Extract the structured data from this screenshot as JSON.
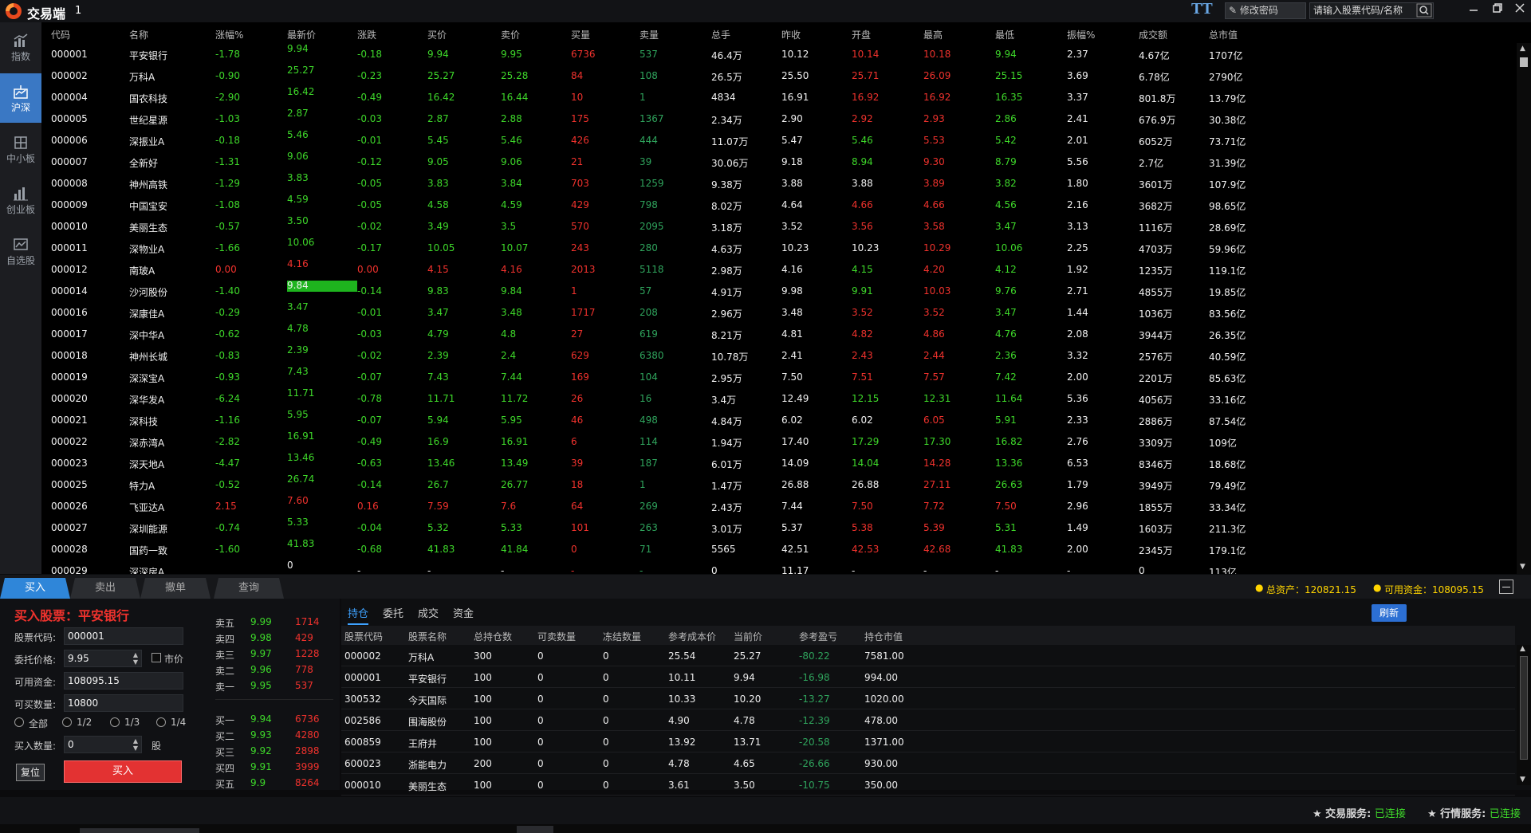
{
  "app": {
    "title": "交易端",
    "version": "1",
    "font_btn": "TT",
    "change_pwd": "修改密码",
    "search_placeholder": "请输入股票代码/名称"
  },
  "sidebar": [
    {
      "label": "指数",
      "icon": "bar-chart-icon"
    },
    {
      "label": "沪深",
      "icon": "market-icon"
    },
    {
      "label": "中小板",
      "icon": "sme-board-icon"
    },
    {
      "label": "创业板",
      "icon": "growth-board-icon"
    },
    {
      "label": "自选股",
      "icon": "watchlist-icon"
    }
  ],
  "quote_columns": [
    "代码",
    "名称",
    "涨幅%",
    "最新价",
    "涨跌",
    "买价",
    "卖价",
    "买量",
    "卖量",
    "总手",
    "昨收",
    "开盘",
    "最高",
    "最低",
    "振幅%",
    "成交额",
    "总市值"
  ],
  "quotes": [
    [
      "000001",
      "平安银行",
      "-1.78",
      "9.94",
      "-0.18",
      "9.94",
      "9.95",
      "6736",
      "537",
      "46.4万",
      "10.12",
      "10.14",
      "10.18",
      "9.94",
      "2.37",
      "4.67亿",
      "1707亿"
    ],
    [
      "000002",
      "万科A",
      "-0.90",
      "25.27",
      "-0.23",
      "25.27",
      "25.28",
      "84",
      "108",
      "26.5万",
      "25.50",
      "25.71",
      "26.09",
      "25.15",
      "3.69",
      "6.78亿",
      "2790亿"
    ],
    [
      "000004",
      "国农科技",
      "-2.90",
      "16.42",
      "-0.49",
      "16.42",
      "16.44",
      "10",
      "1",
      "4834",
      "16.91",
      "16.92",
      "16.92",
      "16.35",
      "3.37",
      "801.8万",
      "13.79亿"
    ],
    [
      "000005",
      "世纪星源",
      "-1.03",
      "2.87",
      "-0.03",
      "2.87",
      "2.88",
      "175",
      "1367",
      "2.34万",
      "2.90",
      "2.92",
      "2.93",
      "2.86",
      "2.41",
      "676.9万",
      "30.38亿"
    ],
    [
      "000006",
      "深振业A",
      "-0.18",
      "5.46",
      "-0.01",
      "5.45",
      "5.46",
      "426",
      "444",
      "11.07万",
      "5.47",
      "5.46",
      "5.53",
      "5.42",
      "2.01",
      "6052万",
      "73.71亿"
    ],
    [
      "000007",
      "全新好",
      "-1.31",
      "9.06",
      "-0.12",
      "9.05",
      "9.06",
      "21",
      "39",
      "30.06万",
      "9.18",
      "8.94",
      "9.30",
      "8.79",
      "5.56",
      "2.7亿",
      "31.39亿"
    ],
    [
      "000008",
      "神州高铁",
      "-1.29",
      "3.83",
      "-0.05",
      "3.83",
      "3.84",
      "703",
      "1259",
      "9.38万",
      "3.88",
      "3.88",
      "3.89",
      "3.82",
      "1.80",
      "3601万",
      "107.9亿"
    ],
    [
      "000009",
      "中国宝安",
      "-1.08",
      "4.59",
      "-0.05",
      "4.58",
      "4.59",
      "429",
      "798",
      "8.02万",
      "4.64",
      "4.66",
      "4.66",
      "4.56",
      "2.16",
      "3682万",
      "98.65亿"
    ],
    [
      "000010",
      "美丽生态",
      "-0.57",
      "3.50",
      "-0.02",
      "3.49",
      "3.5",
      "570",
      "2095",
      "3.18万",
      "3.52",
      "3.56",
      "3.58",
      "3.47",
      "3.13",
      "1116万",
      "28.69亿"
    ],
    [
      "000011",
      "深物业A",
      "-1.66",
      "10.06",
      "-0.17",
      "10.05",
      "10.07",
      "243",
      "280",
      "4.63万",
      "10.23",
      "10.23",
      "10.29",
      "10.06",
      "2.25",
      "4703万",
      "59.96亿"
    ],
    [
      "000012",
      "南玻A",
      "0.00",
      "4.16",
      "0.00",
      "4.15",
      "4.16",
      "2013",
      "5118",
      "2.98万",
      "4.16",
      "4.15",
      "4.20",
      "4.12",
      "1.92",
      "1235万",
      "119.1亿"
    ],
    [
      "000014",
      "沙河股份",
      "-1.40",
      "9.84",
      "-0.14",
      "9.83",
      "9.84",
      "1",
      "57",
      "4.91万",
      "9.98",
      "9.91",
      "10.03",
      "9.76",
      "2.71",
      "4855万",
      "19.85亿"
    ],
    [
      "000016",
      "深康佳A",
      "-0.29",
      "3.47",
      "-0.01",
      "3.47",
      "3.48",
      "1717",
      "208",
      "2.96万",
      "3.48",
      "3.52",
      "3.52",
      "3.47",
      "1.44",
      "1036万",
      "83.56亿"
    ],
    [
      "000017",
      "深中华A",
      "-0.62",
      "4.78",
      "-0.03",
      "4.79",
      "4.8",
      "27",
      "619",
      "8.21万",
      "4.81",
      "4.82",
      "4.86",
      "4.76",
      "2.08",
      "3944万",
      "26.35亿"
    ],
    [
      "000018",
      "神州长城",
      "-0.83",
      "2.39",
      "-0.02",
      "2.39",
      "2.4",
      "629",
      "6380",
      "10.78万",
      "2.41",
      "2.43",
      "2.44",
      "2.36",
      "3.32",
      "2576万",
      "40.59亿"
    ],
    [
      "000019",
      "深深宝A",
      "-0.93",
      "7.43",
      "-0.07",
      "7.43",
      "7.44",
      "169",
      "104",
      "2.95万",
      "7.50",
      "7.51",
      "7.57",
      "7.42",
      "2.00",
      "2201万",
      "85.63亿"
    ],
    [
      "000020",
      "深华发A",
      "-6.24",
      "11.71",
      "-0.78",
      "11.71",
      "11.72",
      "26",
      "16",
      "3.4万",
      "12.49",
      "12.15",
      "12.31",
      "11.64",
      "5.36",
      "4056万",
      "33.16亿"
    ],
    [
      "000021",
      "深科技",
      "-1.16",
      "5.95",
      "-0.07",
      "5.94",
      "5.95",
      "46",
      "498",
      "4.84万",
      "6.02",
      "6.02",
      "6.05",
      "5.91",
      "2.33",
      "2886万",
      "87.54亿"
    ],
    [
      "000022",
      "深赤湾A",
      "-2.82",
      "16.91",
      "-0.49",
      "16.9",
      "16.91",
      "6",
      "114",
      "1.94万",
      "17.40",
      "17.29",
      "17.30",
      "16.82",
      "2.76",
      "3309万",
      "109亿"
    ],
    [
      "000023",
      "深天地A",
      "-4.47",
      "13.46",
      "-0.63",
      "13.46",
      "13.49",
      "39",
      "187",
      "6.01万",
      "14.09",
      "14.04",
      "14.28",
      "13.36",
      "6.53",
      "8346万",
      "18.68亿"
    ],
    [
      "000025",
      "特力A",
      "-0.52",
      "26.74",
      "-0.14",
      "26.7",
      "26.77",
      "18",
      "1",
      "1.47万",
      "26.88",
      "26.88",
      "27.11",
      "26.63",
      "1.79",
      "3949万",
      "79.49亿"
    ],
    [
      "000026",
      "飞亚达A",
      "2.15",
      "7.60",
      "0.16",
      "7.59",
      "7.6",
      "64",
      "269",
      "2.43万",
      "7.44",
      "7.50",
      "7.72",
      "7.50",
      "2.96",
      "1855万",
      "33.34亿"
    ],
    [
      "000027",
      "深圳能源",
      "-0.74",
      "5.33",
      "-0.04",
      "5.32",
      "5.33",
      "101",
      "263",
      "3.01万",
      "5.37",
      "5.38",
      "5.39",
      "5.31",
      "1.49",
      "1603万",
      "211.3亿"
    ],
    [
      "000028",
      "国药一致",
      "-1.60",
      "41.83",
      "-0.68",
      "41.83",
      "41.84",
      "0",
      "71",
      "5565",
      "42.51",
      "42.53",
      "42.68",
      "41.83",
      "2.00",
      "2345万",
      "179.1亿"
    ],
    [
      "000029",
      "深深房A",
      "",
      "0",
      "-",
      "-",
      "-",
      "-",
      "-",
      "0",
      "11.17",
      "-",
      "-",
      "-",
      "-",
      "0",
      "113亿"
    ]
  ],
  "trade_tabs": [
    "买入",
    "卖出",
    "撤单",
    "查询"
  ],
  "account": {
    "total_assets": "总资产：120821.15",
    "available_funds": "可用资金：108095.15"
  },
  "buy_form": {
    "title": "买入股票：平安银行",
    "code_label": "股票代码:",
    "code_value": "000001",
    "price_label": "委托价格:",
    "price_value": "9.95",
    "market_label": "市价",
    "funds_label": "可用资金:",
    "funds_value": "108095.15",
    "max_label": "可买数量:",
    "max_value": "10800",
    "ratios": [
      "全部",
      "1/2",
      "1/3",
      "1/4"
    ],
    "qty_label": "买入数量:",
    "qty_value": "0",
    "qty_unit": "股",
    "reset": "复位",
    "submit": "买入"
  },
  "orderbook": {
    "asks": [
      [
        "卖五",
        "9.99",
        "1714"
      ],
      [
        "卖四",
        "9.98",
        "429"
      ],
      [
        "卖三",
        "9.97",
        "1228"
      ],
      [
        "卖二",
        "9.96",
        "778"
      ],
      [
        "卖一",
        "9.95",
        "537"
      ]
    ],
    "bids": [
      [
        "买一",
        "9.94",
        "6736"
      ],
      [
        "买二",
        "9.93",
        "4280"
      ],
      [
        "买三",
        "9.92",
        "2898"
      ],
      [
        "买四",
        "9.91",
        "3999"
      ],
      [
        "买五",
        "9.9",
        "8264"
      ]
    ]
  },
  "positions": {
    "tabs": [
      "持仓",
      "委托",
      "成交",
      "资金"
    ],
    "refresh": "刷新",
    "columns": [
      "股票代码",
      "股票名称",
      "总持仓数",
      "可卖数量",
      "冻结数量",
      "参考成本价",
      "当前价",
      "参考盈亏",
      "持仓市值"
    ],
    "rows": [
      [
        "000002",
        "万科A",
        "300",
        "0",
        "0",
        "25.54",
        "25.27",
        "-80.22",
        "7581.00"
      ],
      [
        "000001",
        "平安银行",
        "100",
        "0",
        "0",
        "10.11",
        "9.94",
        "-16.98",
        "994.00"
      ],
      [
        "300532",
        "今天国际",
        "100",
        "0",
        "0",
        "10.33",
        "10.20",
        "-13.27",
        "1020.00"
      ],
      [
        "002586",
        "围海股份",
        "100",
        "0",
        "0",
        "4.90",
        "4.78",
        "-12.39",
        "478.00"
      ],
      [
        "600859",
        "王府井",
        "100",
        "0",
        "0",
        "13.92",
        "13.71",
        "-20.58",
        "1371.00"
      ],
      [
        "600023",
        "浙能电力",
        "200",
        "0",
        "0",
        "4.78",
        "4.65",
        "-26.66",
        "930.00"
      ],
      [
        "000010",
        "美丽生态",
        "100",
        "0",
        "0",
        "3.61",
        "3.50",
        "-10.75",
        "350.00"
      ]
    ]
  },
  "status": {
    "trade_label": "★ 交易服务:",
    "trade_state": "已连接",
    "market_label": "★ 行情服务:",
    "market_state": "已连接"
  },
  "colors": {
    "up": "#f0322d",
    "down": "#3ed82a",
    "accent": "#2f86d9",
    "highlight": "#1eb41e"
  }
}
